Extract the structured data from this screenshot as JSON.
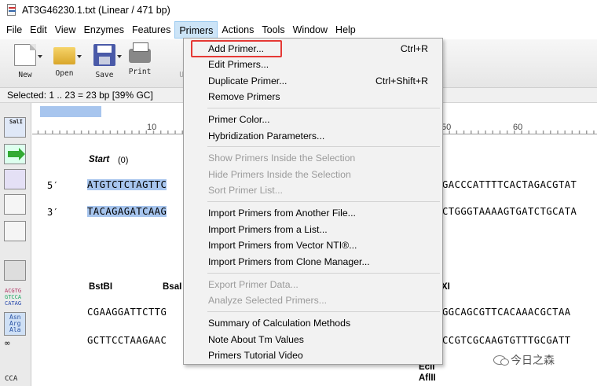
{
  "window": {
    "title": "AT3G46230.1.txt  (Linear / 471 bp)"
  },
  "menubar": [
    "File",
    "Edit",
    "View",
    "Enzymes",
    "Features",
    "Primers",
    "Actions",
    "Tools",
    "Window",
    "Help"
  ],
  "toolbar": {
    "new": "New",
    "open": "Open",
    "save": "Save",
    "print": "Print",
    "undo_partial": "Un"
  },
  "status": {
    "selected": "Selected:  1 .. 23  =  23 bp     [39% GC]"
  },
  "ruler": {
    "ticks": [
      "10",
      "50",
      "60"
    ]
  },
  "sequence": {
    "start_label": "Start",
    "start_pos": "(0)",
    "label_5": "5′",
    "label_3": "3′",
    "row1_top_left": "ATGTCTCTAGTTC",
    "row1_top_right": "GACCCATTTTCACTAGACGTAT",
    "row1_bottom_left": "TACAGAGATCAAG",
    "row1_bottom_right": "CTGGGTAAAAGTGATCTGCATA",
    "enzyme_left1": "BstBI",
    "enzyme_left2": "BsaI",
    "enzyme_right": "XI",
    "row2_top_left": "CGAAGGATTCTTG",
    "row2_top_right": "GGCAGCGTTCACAAACGCTAA",
    "row2_bottom_left": "GCTTCCTAAGAAC",
    "row2_bottom_right": "CCGTCGCAAGTGTTTGCGATT",
    "enzyme_bottom1": "EclI",
    "enzyme_bottom2": "AflII"
  },
  "left_strip": {
    "sali": "SalI",
    "cca": "CCA",
    "codon1": "ACGTG",
    "codon2": "GTCCA",
    "codon3": "CATAG",
    "aa1": "Asn",
    "aa2": "Arg",
    "aa3": "Ala",
    "inf": "∞"
  },
  "primers_menu": {
    "items": [
      {
        "label": "Add Primer...",
        "shortcut": "Ctrl+R",
        "enabled": true
      },
      {
        "label": "Edit Primers...",
        "shortcut": "",
        "enabled": true
      },
      {
        "label": "Duplicate Primer...",
        "shortcut": "Ctrl+Shift+R",
        "enabled": true
      },
      {
        "label": "Remove Primers",
        "shortcut": "",
        "enabled": true
      },
      {
        "label": "Primer Color...",
        "shortcut": "",
        "enabled": true
      },
      {
        "label": "Hybridization Parameters...",
        "shortcut": "",
        "enabled": true
      },
      {
        "label": "Show Primers Inside the Selection",
        "shortcut": "",
        "enabled": false
      },
      {
        "label": "Hide Primers Inside the Selection",
        "shortcut": "",
        "enabled": false
      },
      {
        "label": "Sort Primer List...",
        "shortcut": "",
        "enabled": false
      },
      {
        "label": "Import Primers from Another File...",
        "shortcut": "",
        "enabled": true
      },
      {
        "label": "Import Primers from a List...",
        "shortcut": "",
        "enabled": true
      },
      {
        "label": "Import Primers from Vector NTI®...",
        "shortcut": "",
        "enabled": true
      },
      {
        "label": "Import Primers from Clone Manager...",
        "shortcut": "",
        "enabled": true
      },
      {
        "label": "Export Primer Data...",
        "shortcut": "",
        "enabled": false
      },
      {
        "label": "Analyze Selected Primers...",
        "shortcut": "",
        "enabled": false
      },
      {
        "label": "Summary of Calculation Methods",
        "shortcut": "",
        "enabled": true
      },
      {
        "label": "Note About Tm Values",
        "shortcut": "",
        "enabled": true
      },
      {
        "label": "Primers Tutorial Video",
        "shortcut": "",
        "enabled": true
      }
    ]
  },
  "watermark": {
    "text": "今日之森"
  },
  "colors": {
    "selection": "#a7c5ee",
    "menu_active": "#cce4f7",
    "highlight_box": "#e53935"
  }
}
